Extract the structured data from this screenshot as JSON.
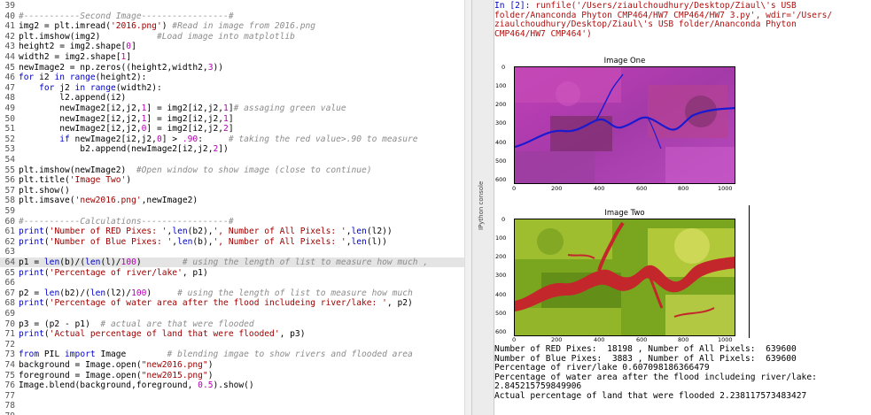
{
  "editor": {
    "lines": [
      {
        "n": "39",
        "segs": []
      },
      {
        "n": "40",
        "segs": [
          {
            "t": "#-----------Second Image-----------------#",
            "c": "cm"
          }
        ]
      },
      {
        "n": "41",
        "segs": [
          {
            "t": "img2 = plt.imread(",
            "c": "tx"
          },
          {
            "t": "'2016.png'",
            "c": "st"
          },
          {
            "t": ") ",
            "c": "tx"
          },
          {
            "t": "#Read in image from 2016.png",
            "c": "cm"
          }
        ]
      },
      {
        "n": "42",
        "segs": [
          {
            "t": "plt.imshow(img2)           ",
            "c": "tx"
          },
          {
            "t": "#Load image into matplotlib",
            "c": "cm"
          }
        ]
      },
      {
        "n": "43",
        "segs": [
          {
            "t": "height2 = img2.shape[",
            "c": "tx"
          },
          {
            "t": "0",
            "c": "nu"
          },
          {
            "t": "]",
            "c": "tx"
          }
        ]
      },
      {
        "n": "44",
        "segs": [
          {
            "t": "width2 = img2.shape[",
            "c": "tx"
          },
          {
            "t": "1",
            "c": "nu"
          },
          {
            "t": "]",
            "c": "tx"
          }
        ]
      },
      {
        "n": "45",
        "segs": [
          {
            "t": "newImage2 = np.zeros((height2,width2,",
            "c": "tx"
          },
          {
            "t": "3",
            "c": "nu"
          },
          {
            "t": "))",
            "c": "tx"
          }
        ]
      },
      {
        "n": "46",
        "segs": [
          {
            "t": "for ",
            "c": "kw"
          },
          {
            "t": "i2 ",
            "c": "tx"
          },
          {
            "t": "in ",
            "c": "kw"
          },
          {
            "t": "range",
            "c": "kw"
          },
          {
            "t": "(height2):",
            "c": "tx"
          }
        ]
      },
      {
        "n": "47",
        "segs": [
          {
            "t": "    ",
            "c": "tx"
          },
          {
            "t": "for ",
            "c": "kw"
          },
          {
            "t": "j2 ",
            "c": "tx"
          },
          {
            "t": "in ",
            "c": "kw"
          },
          {
            "t": "range",
            "c": "kw"
          },
          {
            "t": "(width2):",
            "c": "tx"
          }
        ]
      },
      {
        "n": "48",
        "segs": [
          {
            "t": "        l2.append(i2)",
            "c": "tx"
          }
        ]
      },
      {
        "n": "49",
        "segs": [
          {
            "t": "        newImage2[i2,j2,",
            "c": "tx"
          },
          {
            "t": "1",
            "c": "nu"
          },
          {
            "t": "] = img2[i2,j2,",
            "c": "tx"
          },
          {
            "t": "1",
            "c": "nu"
          },
          {
            "t": "]",
            "c": "tx"
          },
          {
            "t": "# assaging green value",
            "c": "cm"
          }
        ]
      },
      {
        "n": "50",
        "segs": [
          {
            "t": "        newImage2[i2,j2,",
            "c": "tx"
          },
          {
            "t": "1",
            "c": "nu"
          },
          {
            "t": "] = img2[i2,j2,",
            "c": "tx"
          },
          {
            "t": "1",
            "c": "nu"
          },
          {
            "t": "]",
            "c": "tx"
          }
        ]
      },
      {
        "n": "51",
        "segs": [
          {
            "t": "        newImage2[i2,j2,",
            "c": "tx"
          },
          {
            "t": "0",
            "c": "nu"
          },
          {
            "t": "] = img2[i2,j2,",
            "c": "tx"
          },
          {
            "t": "2",
            "c": "nu"
          },
          {
            "t": "]",
            "c": "tx"
          }
        ]
      },
      {
        "n": "52",
        "segs": [
          {
            "t": "        ",
            "c": "tx"
          },
          {
            "t": "if ",
            "c": "kw"
          },
          {
            "t": "newImage2[i2,j2,",
            "c": "tx"
          },
          {
            "t": "0",
            "c": "nu"
          },
          {
            "t": "] > ",
            "c": "tx"
          },
          {
            "t": ".90",
            "c": "nu"
          },
          {
            "t": ":     ",
            "c": "tx"
          },
          {
            "t": "# taking the red value>.90 to measure",
            "c": "cm"
          }
        ]
      },
      {
        "n": "53",
        "segs": [
          {
            "t": "            b2.append(newImage2[i2,j2,",
            "c": "tx"
          },
          {
            "t": "2",
            "c": "nu"
          },
          {
            "t": "])",
            "c": "tx"
          }
        ]
      },
      {
        "n": "54",
        "segs": []
      },
      {
        "n": "55",
        "segs": [
          {
            "t": "plt.imshow(newImage2)  ",
            "c": "tx"
          },
          {
            "t": "#Open window to show image (close to continue)",
            "c": "cm"
          }
        ]
      },
      {
        "n": "56",
        "segs": [
          {
            "t": "plt.title(",
            "c": "tx"
          },
          {
            "t": "'Image Two'",
            "c": "st"
          },
          {
            "t": ")",
            "c": "tx"
          }
        ]
      },
      {
        "n": "57",
        "segs": [
          {
            "t": "plt.show()",
            "c": "tx"
          }
        ]
      },
      {
        "n": "58",
        "segs": [
          {
            "t": "plt.imsave(",
            "c": "tx"
          },
          {
            "t": "'new2016.png'",
            "c": "st"
          },
          {
            "t": ",newImage2)",
            "c": "tx"
          }
        ]
      },
      {
        "n": "59",
        "segs": []
      },
      {
        "n": "60",
        "segs": [
          {
            "t": "#-----------Calculations-----------------#",
            "c": "cm"
          }
        ]
      },
      {
        "n": "61",
        "segs": [
          {
            "t": "print",
            "c": "kw"
          },
          {
            "t": "(",
            "c": "tx"
          },
          {
            "t": "'Number of RED Pixes: '",
            "c": "st"
          },
          {
            "t": ",",
            "c": "tx"
          },
          {
            "t": "len",
            "c": "kw"
          },
          {
            "t": "(b2),",
            "c": "tx"
          },
          {
            "t": "', Number of All Pixels: '",
            "c": "st"
          },
          {
            "t": ",",
            "c": "tx"
          },
          {
            "t": "len",
            "c": "kw"
          },
          {
            "t": "(l2))",
            "c": "tx"
          }
        ]
      },
      {
        "n": "62",
        "segs": [
          {
            "t": "print",
            "c": "kw"
          },
          {
            "t": "(",
            "c": "tx"
          },
          {
            "t": "'Number of Blue Pixes: '",
            "c": "st"
          },
          {
            "t": ",",
            "c": "tx"
          },
          {
            "t": "len",
            "c": "kw"
          },
          {
            "t": "(b),",
            "c": "tx"
          },
          {
            "t": "', Number of All Pixels: '",
            "c": "st"
          },
          {
            "t": ",",
            "c": "tx"
          },
          {
            "t": "len",
            "c": "kw"
          },
          {
            "t": "(l))",
            "c": "tx"
          }
        ]
      },
      {
        "n": "63",
        "segs": []
      },
      {
        "n": "64",
        "segs": [
          {
            "t": "p1 = ",
            "c": "tx"
          },
          {
            "t": "len",
            "c": "kw"
          },
          {
            "t": "(b)/(",
            "c": "tx"
          },
          {
            "t": "len",
            "c": "kw"
          },
          {
            "t": "(l)/",
            "c": "tx"
          },
          {
            "t": "100",
            "c": "nu"
          },
          {
            "t": ")        ",
            "c": "tx"
          },
          {
            "t": "# using the length of list to measure how much ,",
            "c": "cm"
          }
        ],
        "hl": true
      },
      {
        "n": "65",
        "segs": [
          {
            "t": "print",
            "c": "kw"
          },
          {
            "t": "(",
            "c": "tx"
          },
          {
            "t": "'Percentage of river/lake'",
            "c": "st"
          },
          {
            "t": ", p1)",
            "c": "tx"
          }
        ]
      },
      {
        "n": "66",
        "segs": []
      },
      {
        "n": "67",
        "segs": [
          {
            "t": "p2 = ",
            "c": "tx"
          },
          {
            "t": "len",
            "c": "kw"
          },
          {
            "t": "(b2)/(",
            "c": "tx"
          },
          {
            "t": "len",
            "c": "kw"
          },
          {
            "t": "(l2)/",
            "c": "tx"
          },
          {
            "t": "100",
            "c": "nu"
          },
          {
            "t": ")     ",
            "c": "tx"
          },
          {
            "t": "# using the length of list to measure how much",
            "c": "cm"
          }
        ]
      },
      {
        "n": "68",
        "segs": [
          {
            "t": "print",
            "c": "kw"
          },
          {
            "t": "(",
            "c": "tx"
          },
          {
            "t": "'Percentage of water area after the flood includeing river/lake: '",
            "c": "st"
          },
          {
            "t": ", p2)",
            "c": "tx"
          }
        ]
      },
      {
        "n": "69",
        "segs": []
      },
      {
        "n": "70",
        "segs": [
          {
            "t": "p3 = (p2 - p1)  ",
            "c": "tx"
          },
          {
            "t": "# actual are that were flooded",
            "c": "cm"
          }
        ]
      },
      {
        "n": "71",
        "segs": [
          {
            "t": "print",
            "c": "kw"
          },
          {
            "t": "(",
            "c": "tx"
          },
          {
            "t": "'Actual percentage of land that were flooded'",
            "c": "st"
          },
          {
            "t": ", p3)",
            "c": "tx"
          }
        ]
      },
      {
        "n": "72",
        "segs": []
      },
      {
        "n": "73",
        "segs": [
          {
            "t": "from ",
            "c": "kw"
          },
          {
            "t": "PIL ",
            "c": "tx"
          },
          {
            "t": "import ",
            "c": "kw"
          },
          {
            "t": "Image        ",
            "c": "tx"
          },
          {
            "t": "# blending imgae to show rivers and flooded area",
            "c": "cm"
          }
        ]
      },
      {
        "n": "74",
        "segs": [
          {
            "t": "background = Image.open(",
            "c": "tx"
          },
          {
            "t": "\"new2016.png\"",
            "c": "st"
          },
          {
            "t": ")",
            "c": "tx"
          }
        ]
      },
      {
        "n": "75",
        "segs": [
          {
            "t": "foreground = Image.open(",
            "c": "tx"
          },
          {
            "t": "\"new2015.png\"",
            "c": "st"
          },
          {
            "t": ")",
            "c": "tx"
          }
        ]
      },
      {
        "n": "76",
        "segs": [
          {
            "t": "Image.blend(background,foreground, ",
            "c": "tx"
          },
          {
            "t": "0.5",
            "c": "nu"
          },
          {
            "t": ").show()",
            "c": "tx"
          }
        ]
      },
      {
        "n": "77",
        "segs": []
      },
      {
        "n": "78",
        "segs": []
      },
      {
        "n": "79",
        "segs": []
      }
    ]
  },
  "divider": {
    "label": "IPython console"
  },
  "console": {
    "prompt": "In [2]:",
    "runfile_lines": [
      " runfile('/Users/ziaulchoudhury/Desktop/Ziaul\\'s USB",
      "folder/Ananconda Phyton CMP464/HW7 CMP464/HW7 3.py', wdir='/Users/",
      "ziaulchoudhury/Desktop/Ziaul\\'s USB folder/Ananconda Phyton",
      "CMP464/HW7 CMP464')"
    ],
    "plot1": {
      "title": "Image One",
      "yticks": [
        "0",
        "100",
        "200",
        "300",
        "400",
        "500",
        "600"
      ],
      "xticks": [
        "0",
        "200",
        "400",
        "600",
        "800",
        "1000"
      ]
    },
    "plot2": {
      "title": "Image Two",
      "yticks": [
        "0",
        "100",
        "200",
        "300",
        "400",
        "500",
        "600"
      ],
      "xticks": [
        "0",
        "200",
        "400",
        "600",
        "800",
        "1000"
      ]
    },
    "output": [
      "Number of RED Pixes:  18198 , Number of All Pixels:  639600",
      "Number of Blue Pixes:  3883 , Number of All Pixels:  639600",
      "Percentage of river/lake 0.607098186366479",
      "Percentage of water area after the flood includeing river/lake:",
      "2.845215759849906",
      "Actual percentage of land that were flooded 2.238117573483427"
    ]
  },
  "colors": {
    "keyword": "#0000c8",
    "comment": "#8c8c8c",
    "string": "#a00000",
    "number": "#b000b0"
  }
}
